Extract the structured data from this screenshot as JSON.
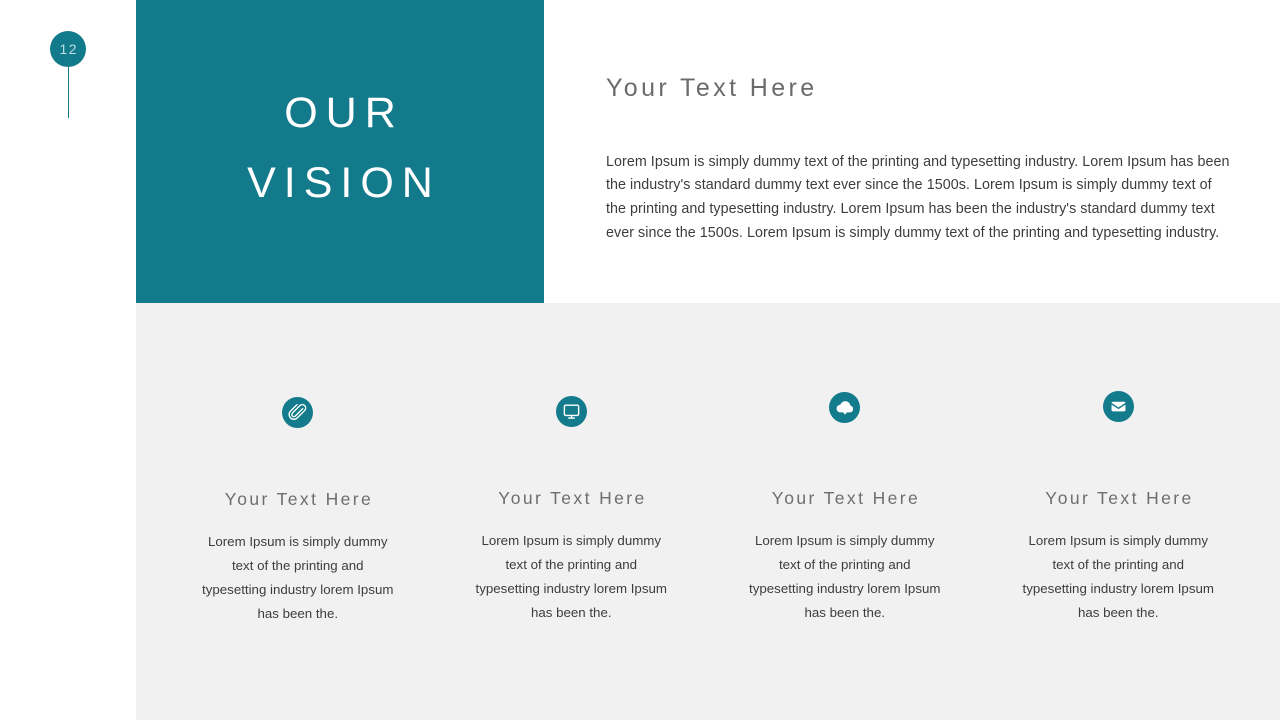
{
  "slide": {
    "page_number": "12",
    "accent_color": "#127a8a",
    "panel_color": "#f1f1f1",
    "background_color": "#ffffff"
  },
  "title_block": {
    "line1": "OUR",
    "line2": "VISION"
  },
  "intro": {
    "heading": "Your Text Here",
    "body": "Lorem Ipsum is simply dummy text of the printing and typesetting industry. Lorem Ipsum has been the industry's standard dummy text ever since the 1500s. Lorem Ipsum is simply dummy text of the printing and typesetting industry. Lorem Ipsum has been the industry's standard dummy text ever since the 1500s. Lorem Ipsum is simply dummy text of the printing and typesetting industry."
  },
  "features": [
    {
      "icon": "paperclip-icon",
      "heading": "Your Text Here",
      "body": "Lorem Ipsum is simply dummy text of the printing and typesetting industry lorem Ipsum has been the."
    },
    {
      "icon": "desktop-monitor-icon",
      "heading": "Your Text Here",
      "body": "Lorem Ipsum is simply dummy text of the printing and typesetting industry lorem Ipsum has been the."
    },
    {
      "icon": "cloud-download-icon",
      "heading": "Your Text Here",
      "body": "Lorem Ipsum is simply dummy text of the printing and typesetting industry lorem Ipsum has been the."
    },
    {
      "icon": "envelope-icon",
      "heading": "Your Text Here",
      "body": "Lorem Ipsum is simply dummy text of the printing and typesetting industry lorem Ipsum has been the."
    }
  ]
}
